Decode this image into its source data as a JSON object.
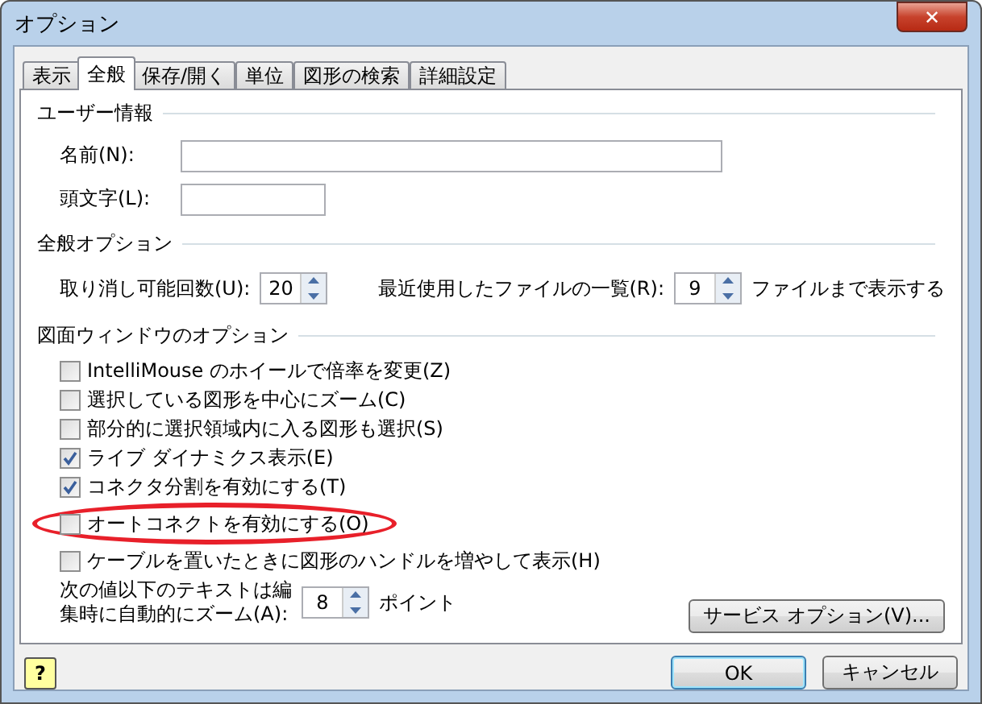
{
  "window": {
    "title": "オプション",
    "close": "✕"
  },
  "tabs": [
    {
      "label": "表示",
      "selected": false
    },
    {
      "label": "全般",
      "selected": true
    },
    {
      "label": "保存/開く",
      "selected": false
    },
    {
      "label": "単位",
      "selected": false
    },
    {
      "label": "図形の検索",
      "selected": false
    },
    {
      "label": "詳細設定",
      "selected": false
    }
  ],
  "user_info": {
    "heading": "ユーザー情報",
    "fields": [
      {
        "label": "名前(N):",
        "wide": true
      },
      {
        "label": "頭文字(L):",
        "wide": false
      }
    ]
  },
  "general_options": {
    "heading": "全般オプション",
    "undo": {
      "label": "取り消し可能回数(U):",
      "value": "20"
    },
    "recent": {
      "label": "最近使用したファイルの一覧(R):",
      "value": "9",
      "suffix": "ファイルまで表示する"
    }
  },
  "drawing_window": {
    "heading": "図面ウィンドウのオプション",
    "checkboxes": [
      {
        "label": "IntelliMouse のホイールで倍率を変更(Z)",
        "checked": false
      },
      {
        "label": "選択している図形を中心にズーム(C)",
        "checked": false
      },
      {
        "label": "部分的に選択領域内に入る図形も選択(S)",
        "checked": false
      },
      {
        "label": "ライブ ダイナミクス表示(E)",
        "checked": true
      },
      {
        "label": "コネクタ分割を有効にする(T)",
        "checked": true
      },
      {
        "label": "オートコネクトを有効にする(O)",
        "checked": false,
        "circled": true
      },
      {
        "label": "ケーブルを置いたときに図形のハンドルを増やして表示(H)",
        "checked": false
      }
    ],
    "zoom": {
      "label_lines": [
        "次の値以下のテキストは編",
        "集時に自動的にズーム(A):"
      ],
      "value": "8",
      "suffix": "ポイント"
    },
    "service_button": "サービス オプション(V)..."
  },
  "buttons": {
    "help": "?",
    "ok": "OK",
    "cancel": "キャンセル"
  }
}
